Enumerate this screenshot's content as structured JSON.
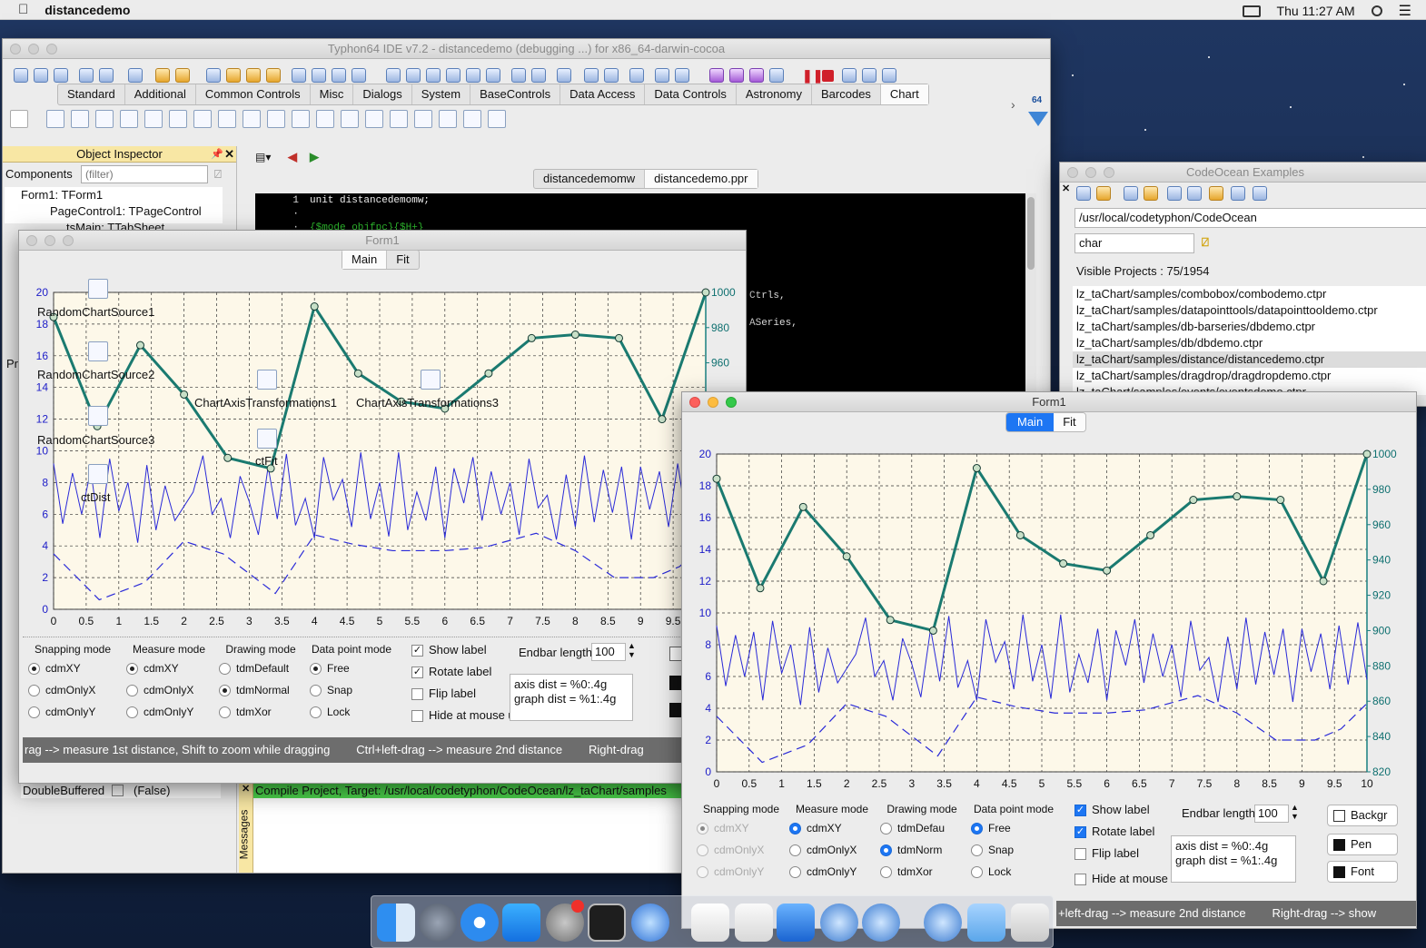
{
  "menubar": {
    "app_name": "distancedemo",
    "clock": "Thu 11:27 AM"
  },
  "ide": {
    "title": "Typhon64 IDE v7.2 - distancedemo (debugging ...) for x86_64-darwin-cocoa",
    "palette_tabs": [
      "Standard",
      "Additional",
      "Common Controls",
      "Misc",
      "Dialogs",
      "System",
      "BaseControls",
      "Data Access",
      "Data Controls",
      "Astronomy",
      "Barcodes",
      "Chart"
    ],
    "selected_tab": "Chart",
    "badge": "64",
    "editor_tabs": [
      "distancedemomw",
      "distancedemo.ppr"
    ],
    "code_lines": [
      {
        "num": "1",
        "text": "unit distancedemomw;"
      },
      {
        "num": "·",
        "text": ""
      },
      {
        "num": "·",
        "text": "{$mode objfpc}{$H+}"
      }
    ],
    "code_fragments": [
      "Ctrls,",
      "ASeries,"
    ],
    "messages_label": "Messages",
    "compile_message": "Compile Project, Target: /usr/local/codetyphon/CodeOcean/lz_taChart/samples"
  },
  "object_inspector": {
    "title": "Object Inspector",
    "components_label": "Components",
    "filter_placeholder": "(filter)",
    "tree": [
      "Form1: TForm1",
      "PageControl1: TPageControl",
      "tsMain: TTabSheet"
    ],
    "prop_name": "DoubleBuffered",
    "prop_value": "(False)",
    "side_label": "Pr"
  },
  "code_ocean": {
    "title": "CodeOcean Examples",
    "path": "/usr/local/codetyphon/CodeOcean",
    "search_value": "char",
    "visible_projects": "Visible Projects : 75/1954",
    "projects": [
      "lz_taChart/samples/combobox/combodemo.ctpr",
      "lz_taChart/samples/datapointtools/datapointtooldemo.ctpr",
      "lz_taChart/samples/db-barseries/dbdemo.ctpr",
      "lz_taChart/samples/db/dbdemo.ctpr",
      "lz_taChart/samples/distance/distancedemo.ctpr",
      "lz_taChart/samples/dragdrop/dragdropdemo.ctpr",
      "lz_taChart/samples/events/eventsdemo.ctpr"
    ],
    "selected_index": 4
  },
  "design_form": {
    "title": "Form1",
    "tabs": [
      "Main",
      "Fit"
    ],
    "components": [
      "RandomChartSource1",
      "RandomChartSource2",
      "RandomChartSource3",
      "ChartAxisTransformations1",
      "ChartAxisTransformations3",
      "ctFit",
      "ctDist"
    ],
    "groups": {
      "snapping": {
        "title": "Snapping mode",
        "options": [
          "cdmXY",
          "cdmOnlyX",
          "cdmOnlyY"
        ]
      },
      "measure": {
        "title": "Measure mode",
        "options": [
          "cdmXY",
          "cdmOnlyX",
          "cdmOnlyY"
        ]
      },
      "drawing": {
        "title": "Drawing mode",
        "options": [
          "tdmDefault",
          "tdmNormal",
          "tdmXor"
        ]
      },
      "datapoint": {
        "title": "Data point mode",
        "options": [
          "Free",
          "Snap",
          "Lock"
        ]
      }
    },
    "checks": [
      "Show label",
      "Rotate label",
      "Flip label",
      "Hide at mouse u"
    ],
    "endbar_label": "Endbar length",
    "endbar_value": "100",
    "memo": [
      "axis dist = %0:.4g",
      "graph dist = %1:.4g"
    ],
    "status": "rag --> measure 1st distance, Shift to zoom while dragging        Ctrl+left-drag --> measure 2nd distance        Right-drag"
  },
  "run_form": {
    "title": "Form1",
    "tabs": [
      "Main",
      "Fit"
    ],
    "groups": {
      "snapping": {
        "title": "Snapping mode",
        "options": [
          "cdmXY",
          "cdmOnlyX",
          "cdmOnlyY"
        ]
      },
      "measure": {
        "title": "Measure mode",
        "options": [
          "cdmXY",
          "cdmOnlyX",
          "cdmOnlyY"
        ]
      },
      "drawing": {
        "title": "Drawing mode",
        "options": [
          "tdmDefau",
          "tdmNorm",
          "tdmXor"
        ]
      },
      "datapoint": {
        "title": "Data point mode",
        "options": [
          "Free",
          "Snap",
          "Lock"
        ]
      }
    },
    "checks": [
      "Show label",
      "Rotate label",
      "Flip label",
      "Hide at mouse u"
    ],
    "endbar_label": "Endbar length",
    "endbar_value": "100",
    "memo": [
      "axis dist = %0:.4g",
      "graph dist = %1:.4g"
    ],
    "buttons": [
      "Backgr",
      "Pen",
      "Font"
    ],
    "status": "+left-drag --> measure 2nd distance        Right-drag --> show"
  },
  "chart_data": {
    "type": "line",
    "xlim": [
      0,
      10
    ],
    "ylim": [
      0,
      20
    ],
    "y2lim": [
      820,
      1000
    ],
    "x_ticks": [
      "0",
      "0.5",
      "1",
      "1.5",
      "2",
      "2.5",
      "3",
      "3.5",
      "4",
      "4.5",
      "5",
      "5.5",
      "6",
      "6.5",
      "7",
      "7.5",
      "8",
      "8.5",
      "9",
      "9.5",
      "10"
    ],
    "y_ticks": [
      "0",
      "2",
      "4",
      "6",
      "8",
      "10",
      "12",
      "14",
      "16",
      "18",
      "20"
    ],
    "y2_ticks": [
      "820",
      "840",
      "860",
      "880",
      "900",
      "920",
      "940",
      "960",
      "980",
      "1000"
    ],
    "grid": true,
    "series": [
      {
        "style": "teal line with circle markers, right axis",
        "x": [
          0,
          0.67,
          1.33,
          2,
          2.67,
          3.33,
          4,
          4.67,
          5.33,
          6,
          6.67,
          7.33,
          8,
          8.67,
          9.33,
          10
        ],
        "y": [
          986,
          924,
          970,
          942,
          906,
          900,
          992,
          954,
          938,
          934,
          954,
          974,
          976,
          974,
          928,
          1000
        ]
      },
      {
        "style": "blue jagged line, left axis",
        "x": [
          0,
          0.14,
          0.29,
          0.43,
          0.57,
          0.71,
          0.86,
          1.0,
          1.14,
          1.29,
          1.43,
          1.57,
          1.71,
          1.86,
          2.0,
          2.14,
          2.29,
          2.43,
          2.57,
          2.71,
          2.86,
          3.0,
          3.14,
          3.29,
          3.43,
          3.57,
          3.71,
          3.86,
          4.0,
          4.14,
          4.29,
          4.43,
          4.57,
          4.71,
          4.86,
          5.0,
          5.14,
          5.29,
          5.43,
          5.57,
          5.71,
          5.86,
          6.0,
          6.14,
          6.29,
          6.43,
          6.57,
          6.71,
          6.86,
          7.0,
          7.14,
          7.29,
          7.43,
          7.57,
          7.71,
          7.86,
          8.0,
          8.14,
          8.29,
          8.43,
          8.57,
          8.71,
          8.86,
          9.0,
          9.14,
          9.29,
          9.43,
          9.57,
          9.71,
          9.86,
          10
        ],
        "y": [
          9.2,
          5.4,
          8.6,
          6.0,
          8.8,
          4.5,
          9.5,
          6.2,
          8.0,
          4.2,
          9.1,
          5.0,
          7.8,
          5.6,
          6.5,
          7.4,
          9.7,
          6.0,
          7.0,
          4.5,
          8.4,
          6.8,
          4.7,
          9.0,
          5.7,
          9.8,
          5.3,
          7.0,
          4.5,
          9.6,
          6.9,
          8.2,
          5.2,
          9.9,
          5.7,
          8.0,
          4.6,
          9.9,
          5.0,
          7.4,
          5.6,
          9.0,
          4.5,
          8.9,
          6.7,
          9.6,
          5.6,
          8.7,
          6.0,
          8.0,
          4.7,
          9.5,
          6.4,
          7.2,
          4.4,
          8.5,
          5.2,
          9.7,
          5.5,
          8.8,
          6.1,
          9.0,
          4.4,
          9.0,
          6.3,
          8.7,
          5.2,
          9.2,
          5.5,
          9.4,
          5.8
        ]
      },
      {
        "style": "blue dashed line, left axis",
        "x": [
          0,
          0.7,
          1.4,
          2.0,
          2.6,
          3.4,
          4.0,
          4.6,
          5.2,
          6.0,
          6.6,
          7.4,
          8.0,
          8.6,
          9.2,
          9.6,
          10
        ],
        "y": [
          3.5,
          0.6,
          1.7,
          4.3,
          3.5,
          1.0,
          4.7,
          4.1,
          3.7,
          3.7,
          3.9,
          4.8,
          3.7,
          2.0,
          2.0,
          2.7,
          4.3
        ]
      }
    ]
  }
}
